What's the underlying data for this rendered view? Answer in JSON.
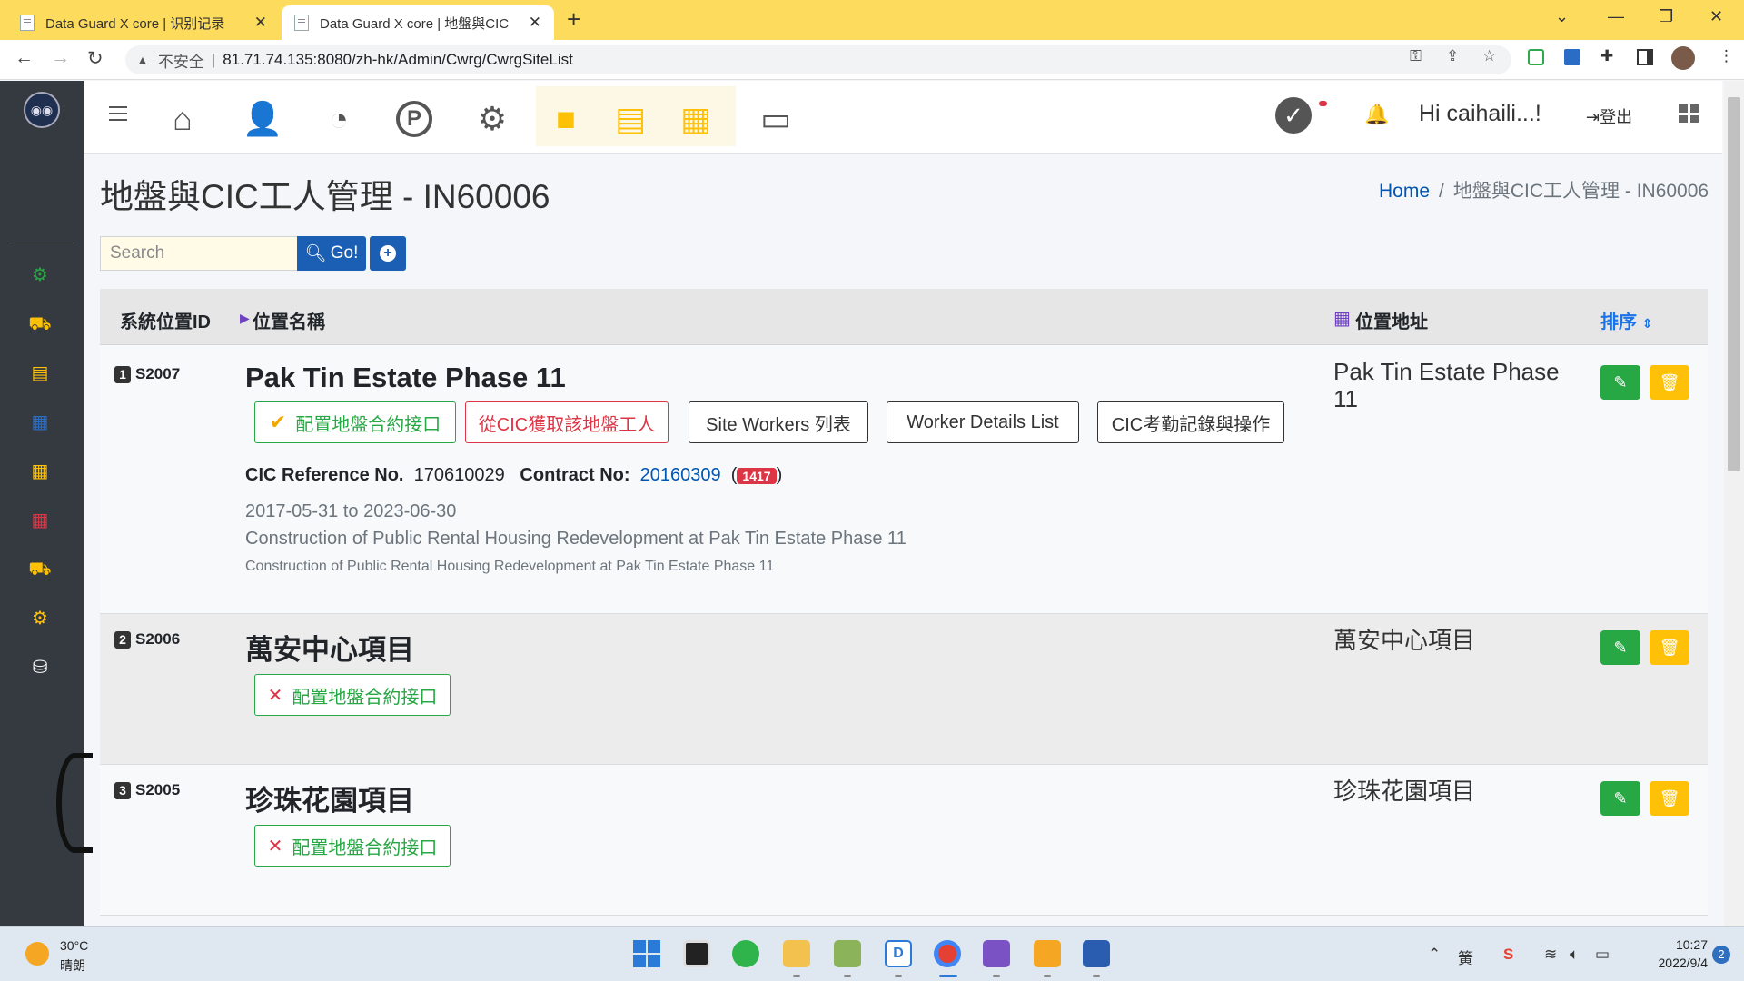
{
  "browser": {
    "tabs": [
      {
        "title": "Data Guard X core | 识别记录"
      },
      {
        "title": "Data Guard X core | 地盤與CIC"
      }
    ],
    "address": {
      "insecure_label": "不安全",
      "url": "81.71.74.135:8080/zh-hk/Admin/Cwrg/CwrgSiteList"
    }
  },
  "topnav": {
    "greeting": "Hi caihaili...!",
    "logout_label": "登出"
  },
  "page": {
    "title": "地盤與CIC工人管理 - IN60006",
    "breadcrumb": {
      "home": "Home",
      "current": "地盤與CIC工人管理 - IN60006"
    }
  },
  "search": {
    "placeholder": "Search",
    "go_label": "Go!"
  },
  "table": {
    "headers": {
      "id": "系統位置ID",
      "name": "位置名稱",
      "address": "位置地址",
      "sort": "排序"
    },
    "rows": [
      {
        "index": "1",
        "id": "S2007",
        "name": "Pak Tin Estate Phase 11",
        "address": "Pak Tin Estate Phase 11",
        "config_label": "配置地盤合約接口",
        "fetch_label": "從CIC獲取該地盤工人",
        "site_workers_label": "Site Workers 列表",
        "worker_details_label": "Worker Details List",
        "attendance_label": "CIC考勤記錄與操作",
        "cic_ref_label": "CIC Reference No.",
        "cic_ref": "170610029",
        "contract_label": "Contract No:",
        "contract_no": "20160309",
        "contract_count": "1417",
        "dates": "2017-05-31 to 2023-06-30",
        "desc": "Construction of Public Rental Housing Redevelopment at Pak Tin Estate Phase 11",
        "desc_small": "Construction of Public Rental Housing Redevelopment at Pak Tin Estate Phase 11"
      },
      {
        "index": "2",
        "id": "S2006",
        "name": "萬安中心項目",
        "address": "萬安中心項目",
        "config_label": "配置地盤合約接口"
      },
      {
        "index": "3",
        "id": "S2005",
        "name": "珍珠花園項目",
        "address": "珍珠花園項目",
        "config_label": "配置地盤合約接口"
      }
    ]
  },
  "taskbar": {
    "weather": {
      "temp": "30°C",
      "desc": "晴朗"
    },
    "ime": "簧",
    "clock": {
      "time": "10:27",
      "date": "2022/9/4"
    },
    "notifications": "2"
  },
  "colors": {
    "tabbar": "#fddb5c",
    "sidebar": "#343a40",
    "primary": "#1a5fb4",
    "success": "#28a745",
    "danger": "#dc3545",
    "warning": "#ffc107"
  }
}
